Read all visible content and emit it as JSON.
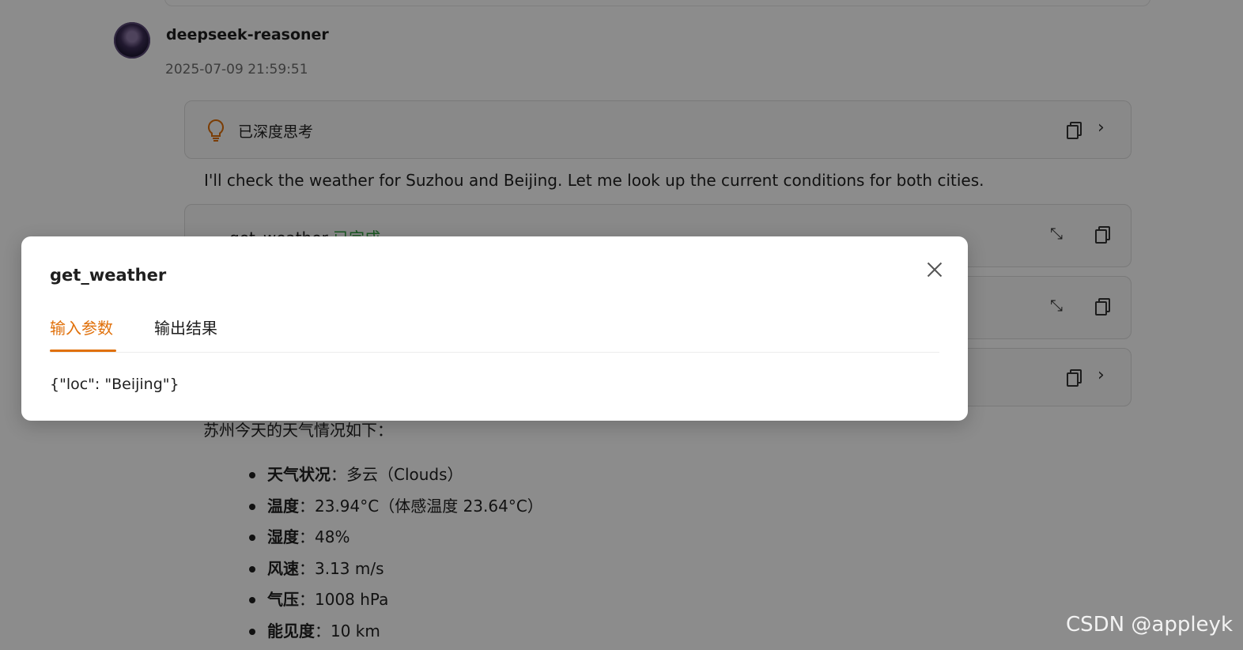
{
  "message": {
    "model_name": "deepseek-reasoner",
    "timestamp": "2025-07-09 21:59:51",
    "thinking_label": "已深度思考",
    "intro_text": "I'll check the weather for Suzhou and Beijing. Let me look up the current conditions for both cities.",
    "tool_calls": [
      {
        "name": "get_weather",
        "status": "已完成"
      }
    ],
    "summary": "苏州今天的天气情况如下：",
    "weather_items": [
      {
        "label": "天气状况",
        "value": "：多云（Clouds）"
      },
      {
        "label": "温度",
        "value": "：23.94°C（体感温度 23.64°C）"
      },
      {
        "label": "湿度",
        "value": "：48%"
      },
      {
        "label": "风速",
        "value": "：3.13 m/s"
      },
      {
        "label": "气压",
        "value": "：1008 hPa"
      },
      {
        "label": "能见度",
        "value": "：10 km"
      }
    ]
  },
  "modal": {
    "title": "get_weather",
    "tabs": [
      {
        "label": "输入参数",
        "active": true
      },
      {
        "label": "输出结果",
        "active": false
      }
    ],
    "params_text": "{\"loc\": \"Beijing\"}"
  },
  "watermark": "CSDN @appleyk",
  "colors": {
    "accent": "#e0700a",
    "done": "#2e9e3e",
    "overlay": "rgba(0,0,0,0.45)"
  },
  "icons": [
    "lightbulb-icon",
    "copy-icon",
    "chevron-right-icon",
    "collapse-icon",
    "close-icon"
  ]
}
